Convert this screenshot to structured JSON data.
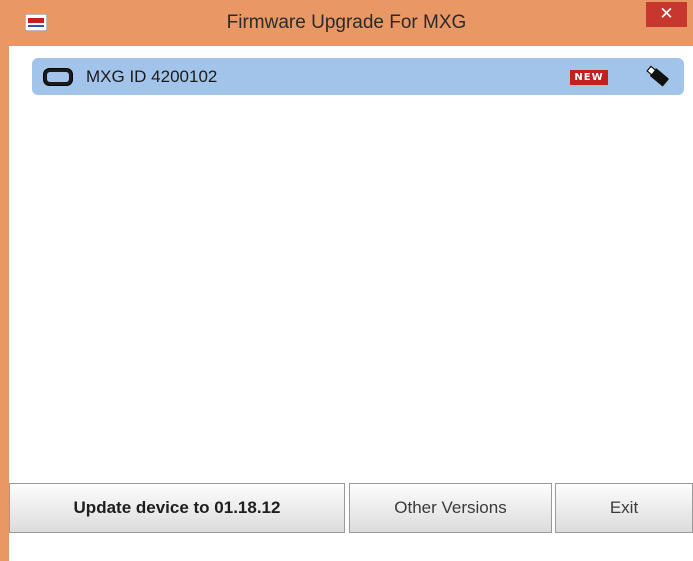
{
  "window": {
    "title": "Firmware Upgrade For MXG",
    "close_symbol": "✕",
    "icons": {
      "app": "aim-logo-icon",
      "close": "close-icon"
    },
    "colors": {
      "titlebar": "#e99865",
      "close": "#c7372d",
      "selection": "#a3c4ea"
    }
  },
  "devices": [
    {
      "label": "MXG ID 4200102",
      "badge": "NEW",
      "icon": "device-icon",
      "connection_icon": "usb-icon",
      "selected": true
    }
  ],
  "buttons": {
    "update": "Update device to 01.18.12",
    "other_versions": "Other Versions",
    "exit": "Exit"
  }
}
